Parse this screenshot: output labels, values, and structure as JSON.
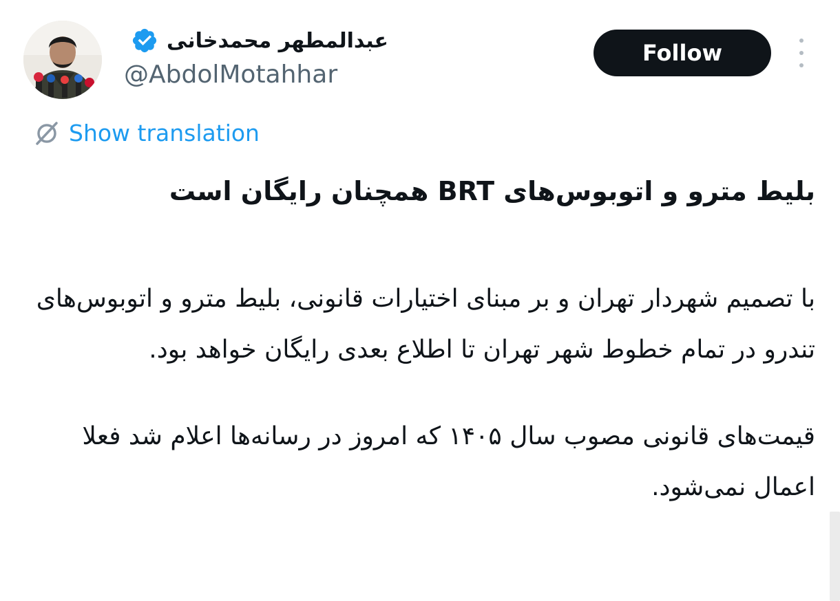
{
  "author": {
    "display_name": "عبدالمطهر محمدخانی",
    "handle": "@AbdolMotahhar",
    "verified_icon": "verified-badge-icon",
    "verified_color": "#1d9bf0"
  },
  "actions": {
    "follow_label": "Follow",
    "more_icon": "more-vertical-icon"
  },
  "translation": {
    "label": "Show translation",
    "icon": "translate-icon",
    "color": "#1d9bf0"
  },
  "tweet": {
    "title": "بلیط مترو و اتوبوس‌های BRT همچنان رایگان است",
    "paragraph1": "با تصمیم شهردار تهران و بر مبنای اختیارات قانونی، بلیط مترو و اتوبوس‌های تندرو در تمام خطوط شهر تهران تا اطلاع بعدی رایگان خواهد بود.",
    "paragraph2": "قیمت‌های قانونی مصوب سال ۱۴۰۵ که امروز در رسانه‌ها اعلام شد فعلا اعمال نمی‌شود."
  },
  "colors": {
    "text": "#0f1419",
    "secondary_text": "#536471",
    "follow_bg": "#0f1419",
    "follow_text": "#ffffff"
  }
}
